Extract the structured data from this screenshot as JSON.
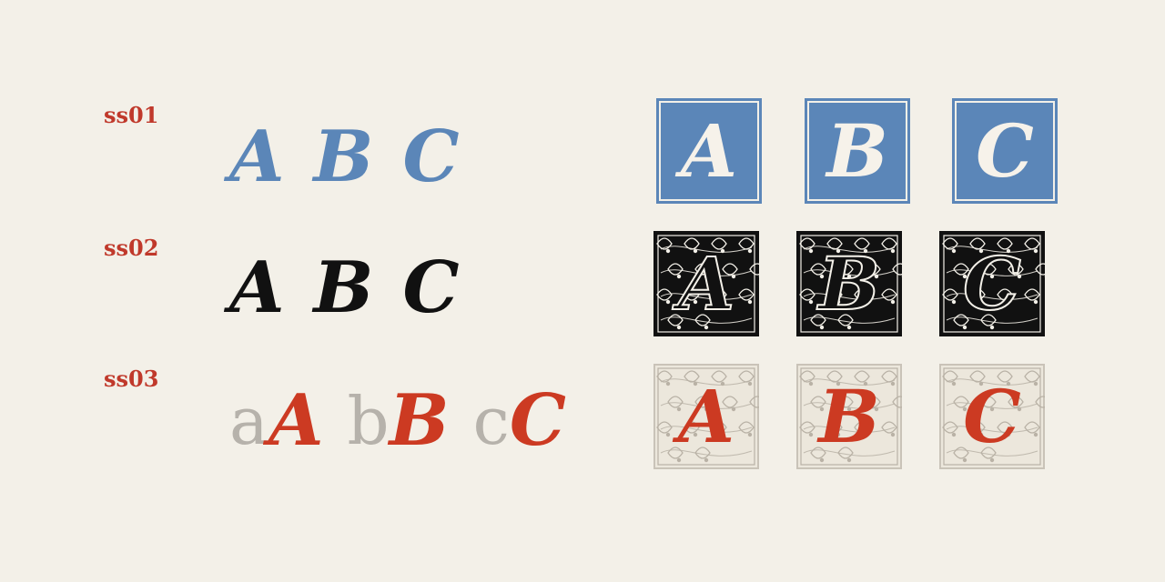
{
  "colors": {
    "background": "#f3f0e8",
    "label_red": "#c0392b",
    "blue": "#5b86b8",
    "black": "#111111",
    "red": "#cc3a22",
    "grey": "#b6b2ab",
    "ornament_frame": "#c9c3b8"
  },
  "sets": [
    {
      "label": "ss01",
      "letters": [
        "A",
        "B",
        "C"
      ],
      "initials": [
        "A",
        "B",
        "C"
      ],
      "style": "blue plain square"
    },
    {
      "label": "ss02",
      "letters": [
        "A",
        "B",
        "C"
      ],
      "initials": [
        "A",
        "B",
        "C"
      ],
      "style": "black ornamental"
    },
    {
      "label": "ss03",
      "pairs": [
        {
          "lower": "a",
          "upper": "A"
        },
        {
          "lower": "b",
          "upper": "B"
        },
        {
          "lower": "c",
          "upper": "C"
        }
      ],
      "initials": [
        "A",
        "B",
        "C"
      ],
      "style": "red ornamental on light ground"
    }
  ]
}
